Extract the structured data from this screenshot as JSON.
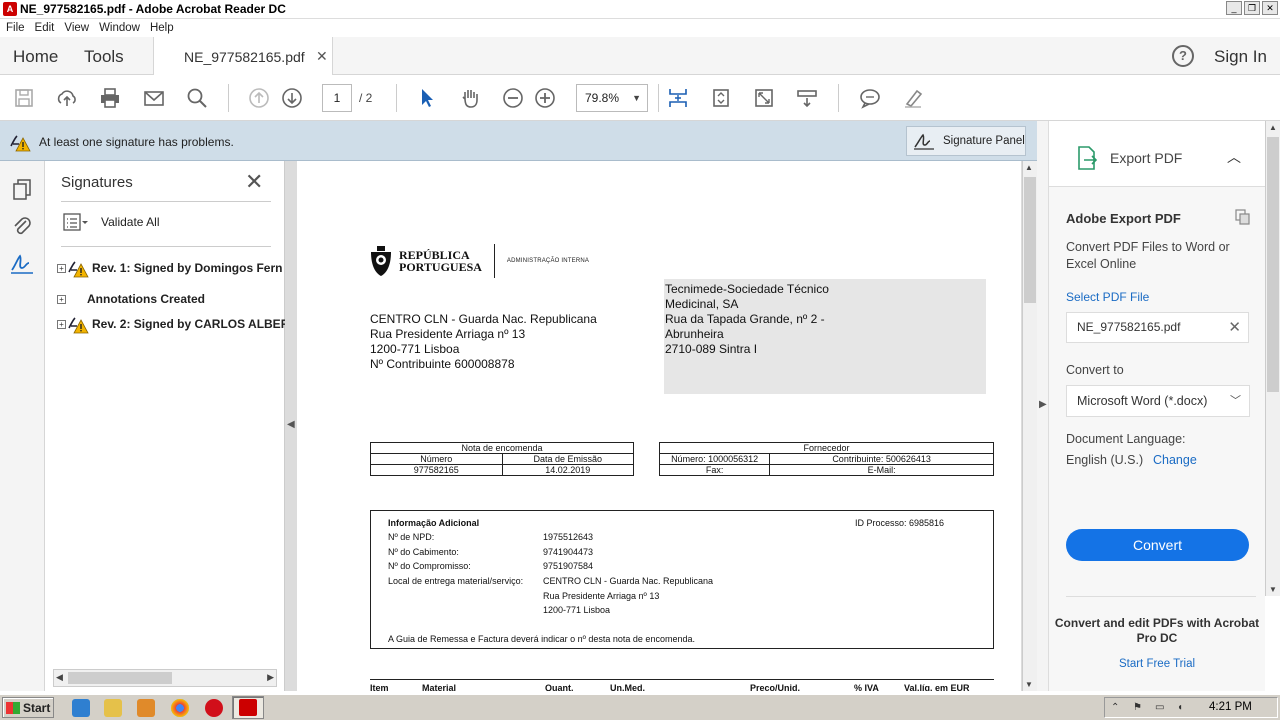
{
  "window": {
    "title": "NE_977582165.pdf - Adobe Acrobat Reader DC"
  },
  "menu": [
    "File",
    "Edit",
    "View",
    "Window",
    "Help"
  ],
  "tabs": {
    "home": "Home",
    "tools": "Tools",
    "doc": "NE_977582165.pdf",
    "signin": "Sign In"
  },
  "toolbar": {
    "page_current": "1",
    "page_total": "/ 2",
    "zoom": "79.8%"
  },
  "notification": {
    "message": "At least one signature has problems.",
    "button": "Signature Panel"
  },
  "signatures": {
    "title": "Signatures",
    "validate_all": "Validate All",
    "items": [
      {
        "label": "Rev. 1: Signed by Domingos Fern"
      },
      {
        "label": "Annotations Created"
      },
      {
        "label": "Rev. 2: Signed by CARLOS ALBER"
      }
    ]
  },
  "document": {
    "logo_line1": "REPÚBLICA",
    "logo_line2": "PORTUGUESA",
    "logo_sub": "ADMINISTRAÇÃO INTERNA",
    "sender": [
      "CENTRO CLN - Guarda Nac. Republicana",
      "Rua Presidente Arriaga nº 13",
      "1200-771 Lisboa",
      "Nº Contribuinte 600008878"
    ],
    "supplier": [
      "Tecnimede-Sociedade Técnico",
      "Medicinal, SA",
      "Rua da Tapada Grande, nº 2 -",
      "Abrunheira",
      "2710-089 Sintra I"
    ],
    "order_table": {
      "title": "Nota de encomenda",
      "h1": "Número",
      "h2": "Data de Emissão",
      "v1": "977582165",
      "v2": "14.02.2019"
    },
    "supplier_table": {
      "title": "Fornecedor",
      "numero": "Número: 1000056312",
      "contrib": "Contribuinte: 500626413",
      "fax": "Fax:",
      "email": "E-Mail:"
    },
    "info": {
      "heading": "Informação Adicional",
      "id_processo": "ID Processo: 6985816",
      "rows": [
        {
          "label": "Nº de NPD:",
          "value": "1975512643"
        },
        {
          "label": "Nº do Cabimento:",
          "value": "9741904473"
        },
        {
          "label": "Nº do Compromisso:",
          "value": "9751907584"
        },
        {
          "label": "Local de entrega material/serviço:",
          "value": "CENTRO CLN - Guarda Nac. Republicana"
        },
        {
          "label": "",
          "value": "Rua Presidente Arriaga nº 13"
        },
        {
          "label": "",
          "value": "1200-771 Lisboa"
        }
      ],
      "footer": "A Guia de Remessa e Factura deverá indicar o nº desta nota de encomenda."
    },
    "items_header": [
      "Item",
      "Material",
      "Quant.",
      "Un.Med.",
      "Preço/Unid.",
      "% IVA",
      "Val.líq. em EUR"
    ]
  },
  "export_panel": {
    "header": "Export PDF",
    "title": "Adobe Export PDF",
    "desc": "Convert PDF Files to Word or Excel Online",
    "select_label": "Select PDF File",
    "file": "NE_977582165.pdf",
    "convert_to": "Convert to",
    "format": "Microsoft Word (*.docx)",
    "lang_label": "Document Language:",
    "lang_value": "English (U.S.)",
    "change": "Change",
    "convert_btn": "Convert",
    "promo": "Convert and edit PDFs with Acrobat Pro DC",
    "trial": "Start Free Trial"
  },
  "taskbar": {
    "start": "Start",
    "time": "4:21 PM"
  },
  "colors": {
    "accent": "#1473e6",
    "notif_bg": "#cfdde8",
    "link": "#1a6bc4"
  }
}
